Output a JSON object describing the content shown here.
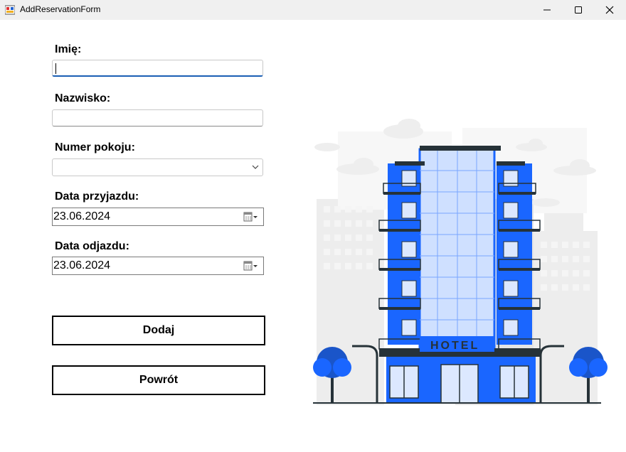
{
  "window": {
    "title": "AddReservationForm"
  },
  "form": {
    "first_name": {
      "label": "Imię:",
      "value": ""
    },
    "last_name": {
      "label": "Nazwisko:",
      "value": ""
    },
    "room_number": {
      "label": "Numer pokoju:",
      "selected": ""
    },
    "arrival_date": {
      "label": "Data przyjazdu:",
      "value": "23.06.2024"
    },
    "departure_date": {
      "label": "Data odjazdu:",
      "value": "23.06.2024"
    },
    "add_button": "Dodaj",
    "back_button": "Powrót"
  },
  "illustration": {
    "sign": "HOTEL",
    "accent": "#1a66ff",
    "dark": "#263238"
  }
}
